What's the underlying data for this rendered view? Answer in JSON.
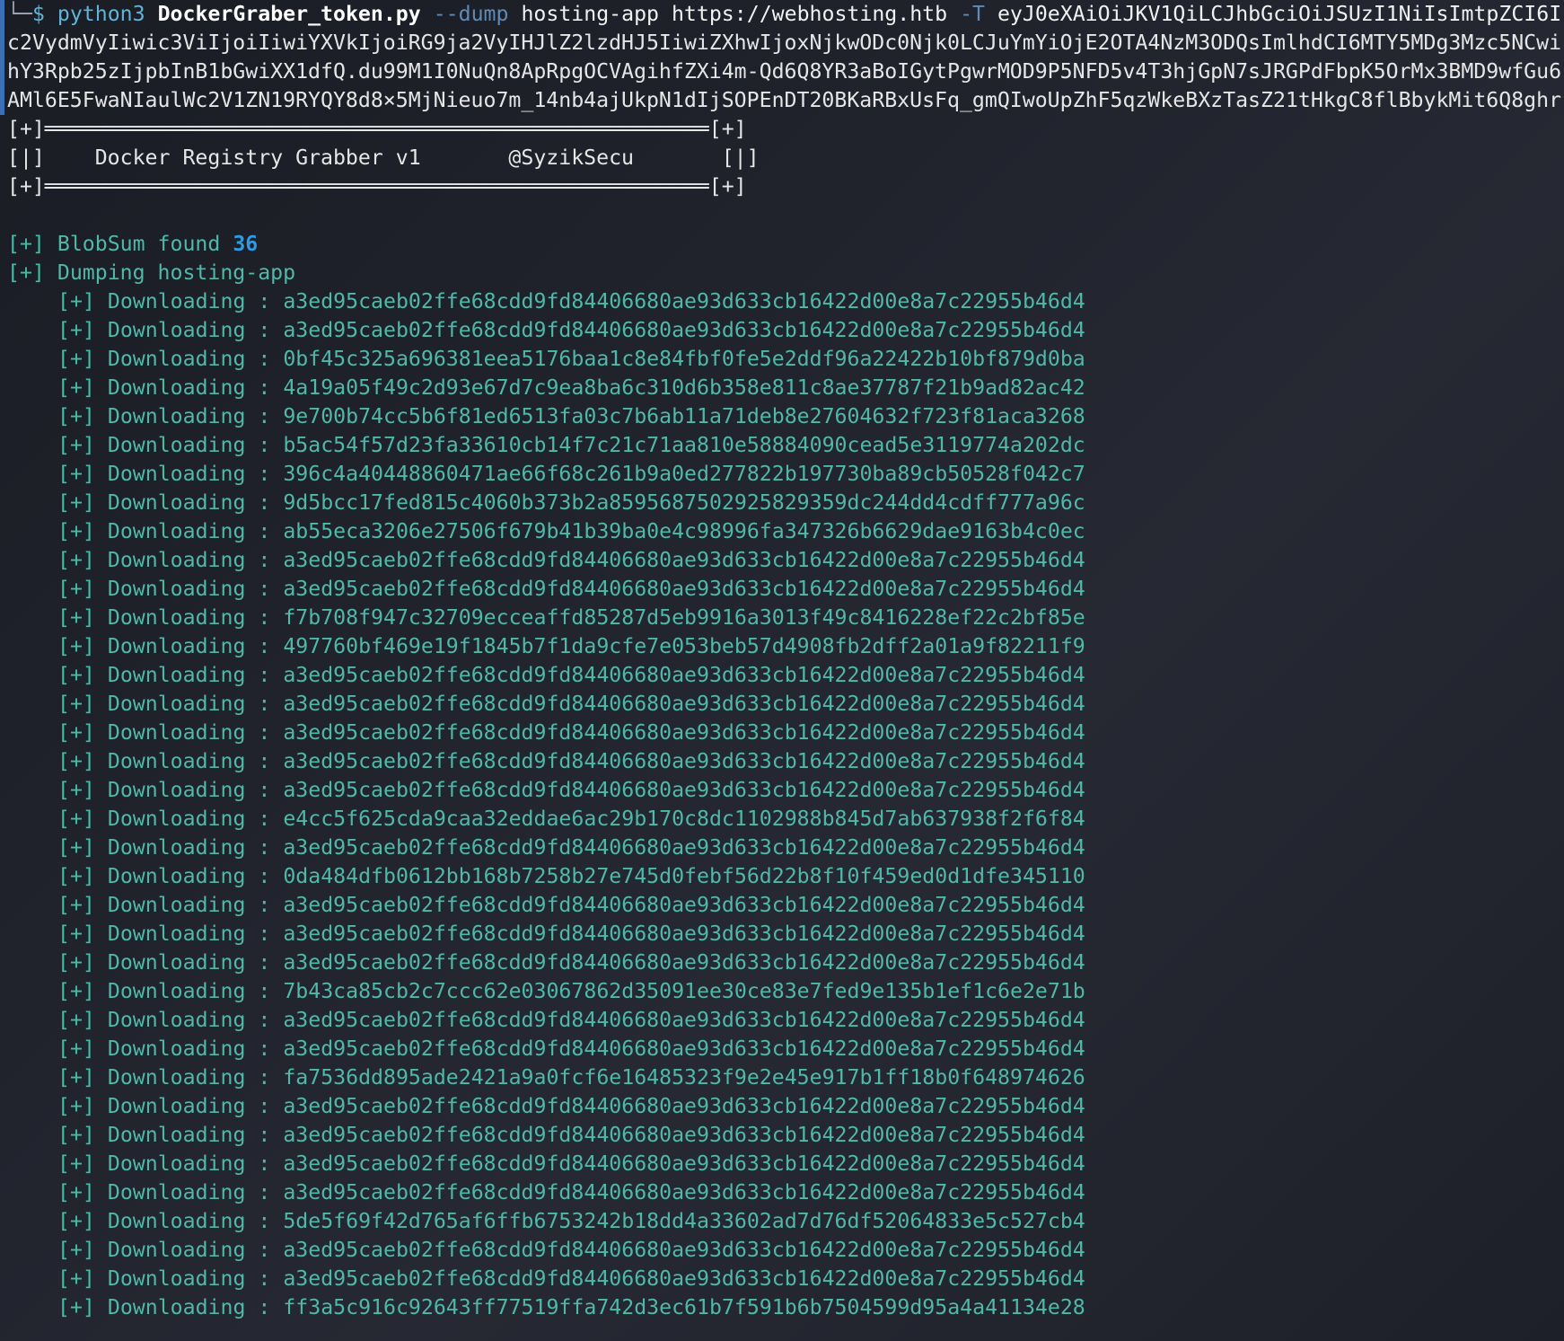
{
  "prompt": {
    "corner": "└─",
    "dollar": "$",
    "cmd": "python3",
    "script": "DockerGraber_token.py",
    "flag_dump": "--dump",
    "app": "hosting-app",
    "url": "https://webhosting.htb",
    "flag_t": "-T",
    "token_start": "eyJ0eXAiOiJKV1QiLCJhbGciOiJSUzI1NiIsImtpZCI6I"
  },
  "token_lines": [
    "c2VydmVyIiwic3ViIjoiIiwiYXVkIjoiRG9ja2VyIHJlZ2lzdHJ5IiwiZXhwIjoxNjkwODc0Njk0LCJuYmYiOjE2OTA4NzM3ODQsImlhdCI6MTY5MDg3Mzc5NCwi",
    "hY3Rpb25zIjpbInB1bGwiXX1dfQ.du99M1I0NuQn8ApRpgOCVAgihfZXi4m-Qd6Q8YR3aBoIGytPgwrMOD9P5NFD5v4T3hjGpN7sJRGPdFbpK5OrMx3BMD9wfGu6",
    "AMl6E5FwaNIaulWc2V1ZN19RYQY8d8×5MjNieuo7m_14nb4ajUkpN1dIjSOPEnDT20BKaRBxUsFq_gmQIwoUpZhF5qzWkeBXzTasZ21tHkgC8flBbykMit6Q8ghr"
  ],
  "banner": {
    "top": "[+]═════════════════════════════════════════════════════[+]",
    "middle": "[|]    Docker Registry Grabber v1       @SyzikSecu       [|]",
    "bottom": "[+]═════════════════════════════════════════════════════[+]"
  },
  "status": {
    "marker": "[+]",
    "blobsum_label": "BlobSum found",
    "blobsum_count": "36",
    "dumping_label": "Dumping hosting-app"
  },
  "downloads_label": "Downloading :",
  "downloads": [
    "a3ed95caeb02ffe68cdd9fd84406680ae93d633cb16422d00e8a7c22955b46d4",
    "a3ed95caeb02ffe68cdd9fd84406680ae93d633cb16422d00e8a7c22955b46d4",
    "0bf45c325a696381eea5176baa1c8e84fbf0fe5e2ddf96a22422b10bf879d0ba",
    "4a19a05f49c2d93e67d7c9ea8ba6c310d6b358e811c8ae37787f21b9ad82ac42",
    "9e700b74cc5b6f81ed6513fa03c7b6ab11a71deb8e27604632f723f81aca3268",
    "b5ac54f57d23fa33610cb14f7c21c71aa810e58884090cead5e3119774a202dc",
    "396c4a40448860471ae66f68c261b9a0ed277822b197730ba89cb50528f042c7",
    "9d5bcc17fed815c4060b373b2a8595687502925829359dc244dd4cdff777a96c",
    "ab55eca3206e27506f679b41b39ba0e4c98996fa347326b6629dae9163b4c0ec",
    "a3ed95caeb02ffe68cdd9fd84406680ae93d633cb16422d00e8a7c22955b46d4",
    "a3ed95caeb02ffe68cdd9fd84406680ae93d633cb16422d00e8a7c22955b46d4",
    "f7b708f947c32709ecceaffd85287d5eb9916a3013f49c8416228ef22c2bf85e",
    "497760bf469e19f1845b7f1da9cfe7e053beb57d4908fb2dff2a01a9f82211f9",
    "a3ed95caeb02ffe68cdd9fd84406680ae93d633cb16422d00e8a7c22955b46d4",
    "a3ed95caeb02ffe68cdd9fd84406680ae93d633cb16422d00e8a7c22955b46d4",
    "a3ed95caeb02ffe68cdd9fd84406680ae93d633cb16422d00e8a7c22955b46d4",
    "a3ed95caeb02ffe68cdd9fd84406680ae93d633cb16422d00e8a7c22955b46d4",
    "a3ed95caeb02ffe68cdd9fd84406680ae93d633cb16422d00e8a7c22955b46d4",
    "e4cc5f625cda9caa32eddae6ac29b170c8dc1102988b845d7ab637938f2f6f84",
    "a3ed95caeb02ffe68cdd9fd84406680ae93d633cb16422d00e8a7c22955b46d4",
    "0da484dfb0612bb168b7258b27e745d0febf56d22b8f10f459ed0d1dfe345110",
    "a3ed95caeb02ffe68cdd9fd84406680ae93d633cb16422d00e8a7c22955b46d4",
    "a3ed95caeb02ffe68cdd9fd84406680ae93d633cb16422d00e8a7c22955b46d4",
    "a3ed95caeb02ffe68cdd9fd84406680ae93d633cb16422d00e8a7c22955b46d4",
    "7b43ca85cb2c7ccc62e03067862d35091ee30ce83e7fed9e135b1ef1c6e2e71b",
    "a3ed95caeb02ffe68cdd9fd84406680ae93d633cb16422d00e8a7c22955b46d4",
    "a3ed95caeb02ffe68cdd9fd84406680ae93d633cb16422d00e8a7c22955b46d4",
    "fa7536dd895ade2421a9a0fcf6e16485323f9e2e45e917b1ff18b0f648974626",
    "a3ed95caeb02ffe68cdd9fd84406680ae93d633cb16422d00e8a7c22955b46d4",
    "a3ed95caeb02ffe68cdd9fd84406680ae93d633cb16422d00e8a7c22955b46d4",
    "a3ed95caeb02ffe68cdd9fd84406680ae93d633cb16422d00e8a7c22955b46d4",
    "a3ed95caeb02ffe68cdd9fd84406680ae93d633cb16422d00e8a7c22955b46d4",
    "5de5f69f42d765af6ffb6753242b18dd4a33602ad7d76df52064833e5c527cb4",
    "a3ed95caeb02ffe68cdd9fd84406680ae93d633cb16422d00e8a7c22955b46d4",
    "a3ed95caeb02ffe68cdd9fd84406680ae93d633cb16422d00e8a7c22955b46d4",
    "ff3a5c916c92643ff77519ffa742d3ec61b7f591b6b7504599d95a4a41134e28"
  ],
  "colors": {
    "background": "#20222c",
    "prompt_accent": "#5fb4d9",
    "marker_teal": "#3fbfa8",
    "count_blue": "#2f9be0"
  }
}
